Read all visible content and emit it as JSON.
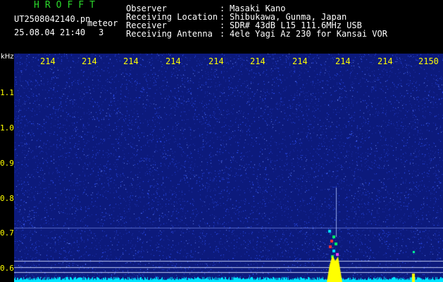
{
  "header": {
    "app_title": "HROFFT",
    "filename": "UT2508042140.pn",
    "suffix": "meteor",
    "timestamp": "25.08.04 21:40",
    "count": "3",
    "info": [
      {
        "label": "Observer",
        "value": "Masaki Kano"
      },
      {
        "label": "Receiving Location",
        "value": "Shibukawa, Gunma, Japan"
      },
      {
        "label": "Receiver",
        "value": "SDR# 43dB L15 111.6MHz USB"
      },
      {
        "label": "Receiving Antenna",
        "value": "4ele Yagi Az 230 for Kansai VOR"
      }
    ],
    "colon": ":"
  },
  "axis": {
    "y_unit": "kHz",
    "y_ticks": [
      "1.1",
      "1.0",
      "0.9",
      "0.8",
      "0.7",
      "0.6"
    ],
    "x_ticks": [
      "214",
      "214",
      "214",
      "214",
      "214",
      "214",
      "214",
      "214",
      "214",
      "2150"
    ]
  },
  "colors": {
    "background": "#0c1a7c",
    "noise": "#2f52ff",
    "title": "#2bd82b",
    "ticks": "#ffff00",
    "baseline": "#00e5ff",
    "echo": "#ffff00"
  }
}
